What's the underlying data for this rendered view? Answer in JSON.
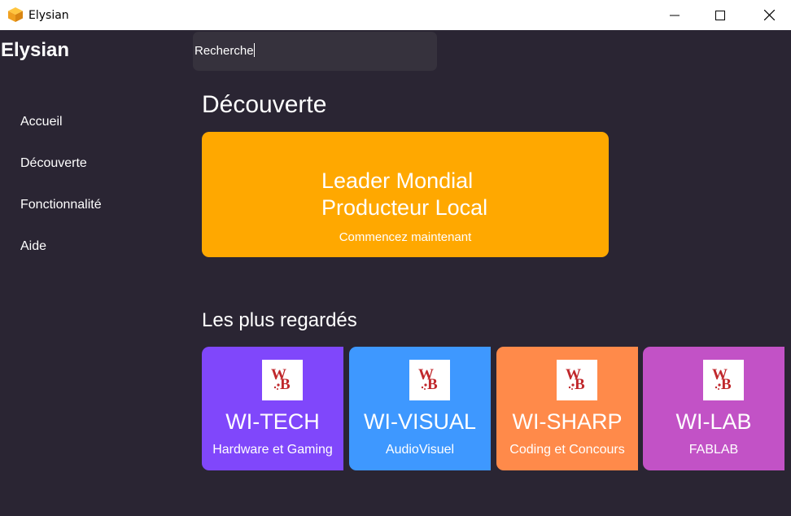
{
  "window": {
    "title": "Elysian"
  },
  "app": {
    "name": "Elysian"
  },
  "search": {
    "value": "Recherche"
  },
  "nav": {
    "items": [
      {
        "label": "Accueil"
      },
      {
        "label": "Découverte"
      },
      {
        "label": "Fonctionnalité"
      },
      {
        "label": "Aide"
      }
    ]
  },
  "discover": {
    "title": "Découverte",
    "hero": {
      "line1": "Leader Mondial",
      "line2": "Producteur Local",
      "cta": "Commencez maintenant",
      "color": "#ffa800"
    }
  },
  "popular": {
    "title": "Les plus regardés",
    "cards": [
      {
        "title": "WI-TECH",
        "subtitle": "Hardware et Gaming",
        "color": "#8047fb",
        "icon": "wb-logo-icon"
      },
      {
        "title": "WI-VISUAL",
        "subtitle": "AudioVisuel",
        "color": "#3e98ff",
        "icon": "wb-logo-icon"
      },
      {
        "title": "WI-SHARP",
        "subtitle": "Coding et Concours",
        "color": "#ff8a4a",
        "icon": "wb-logo-icon"
      },
      {
        "title": "WI-LAB",
        "subtitle": "FABLAB",
        "color": "#c252c6",
        "icon": "wb-logo-icon"
      }
    ]
  },
  "colors": {
    "background": "#2a2533",
    "search_bg": "#36323d",
    "titlebar": "#ffffff"
  }
}
